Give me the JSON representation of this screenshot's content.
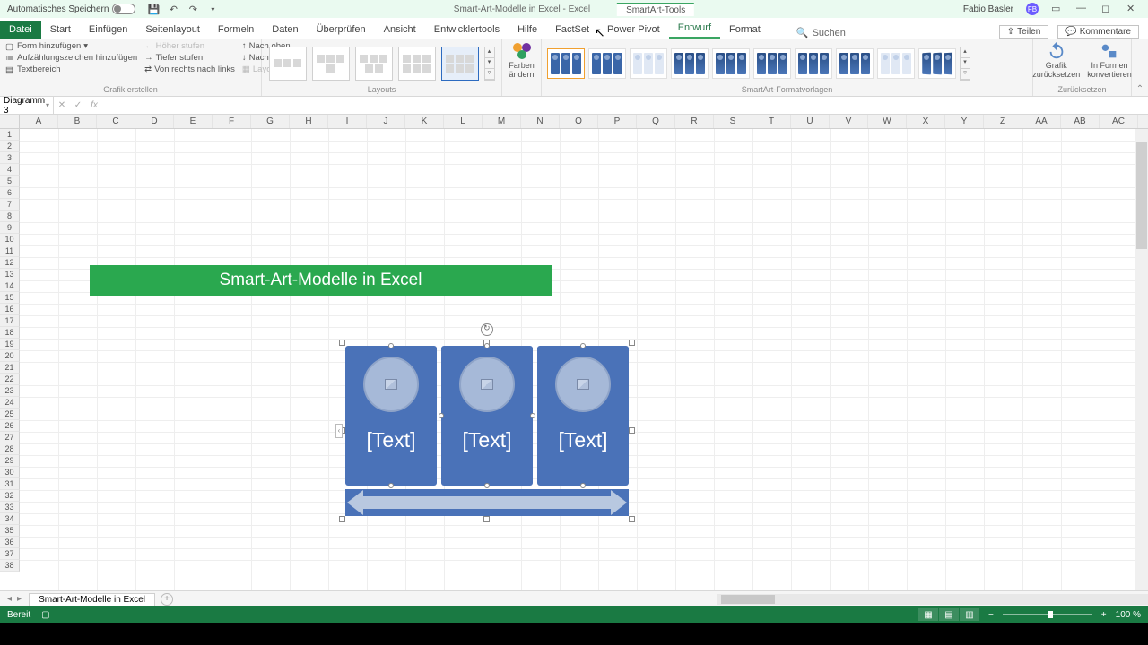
{
  "titlebar": {
    "autosave_label": "Automatisches Speichern",
    "doc_title": "Smart-Art-Modelle in Excel - Excel",
    "context_tab": "SmartArt-Tools",
    "user_name": "Fabio Basler",
    "user_initials": "FB"
  },
  "tabs": {
    "file": "Datei",
    "list": [
      "Start",
      "Einfügen",
      "Seitenlayout",
      "Formeln",
      "Daten",
      "Überprüfen",
      "Ansicht",
      "Entwicklertools",
      "Hilfe",
      "FactSet",
      "Power Pivot"
    ],
    "context": [
      "Entwurf",
      "Format"
    ],
    "active": "Entwurf",
    "search": "Suchen",
    "share": "Teilen",
    "comments": "Kommentare"
  },
  "ribbon": {
    "create": {
      "add_shape": "Form hinzufügen",
      "add_bullet": "Aufzählungszeichen hinzufügen",
      "text_pane": "Textbereich",
      "promote": "Höher stufen",
      "demote": "Tiefer stufen",
      "rtl": "Von rechts nach links",
      "move_up": "Nach oben",
      "move_down": "Nach unten",
      "layout_dd": "Layout",
      "group_label": "Grafik erstellen"
    },
    "layouts": {
      "group_label": "Layouts"
    },
    "colors": {
      "label": "Farben ändern"
    },
    "styles": {
      "group_label": "SmartArt-Formatvorlagen"
    },
    "reset": {
      "reset_graphic": "Grafik zurücksetzen",
      "convert": "In Formen konvertieren",
      "group_label": "Zurücksetzen"
    }
  },
  "formula": {
    "name_box": "Diagramm 3"
  },
  "columns": [
    "A",
    "B",
    "C",
    "D",
    "E",
    "F",
    "G",
    "H",
    "I",
    "J",
    "K",
    "L",
    "M",
    "N",
    "O",
    "P",
    "Q",
    "R",
    "S",
    "T",
    "U",
    "V",
    "W",
    "X",
    "Y",
    "Z",
    "AA",
    "AB",
    "AC"
  ],
  "rows": 38,
  "banner": {
    "text": "Smart-Art-Modelle in Excel"
  },
  "smartart": {
    "placeholders": [
      "[Text]",
      "[Text]",
      "[Text]"
    ]
  },
  "sheet": {
    "tab1": "Smart-Art-Modelle in Excel"
  },
  "status": {
    "ready": "Bereit",
    "zoom": "100 %"
  }
}
